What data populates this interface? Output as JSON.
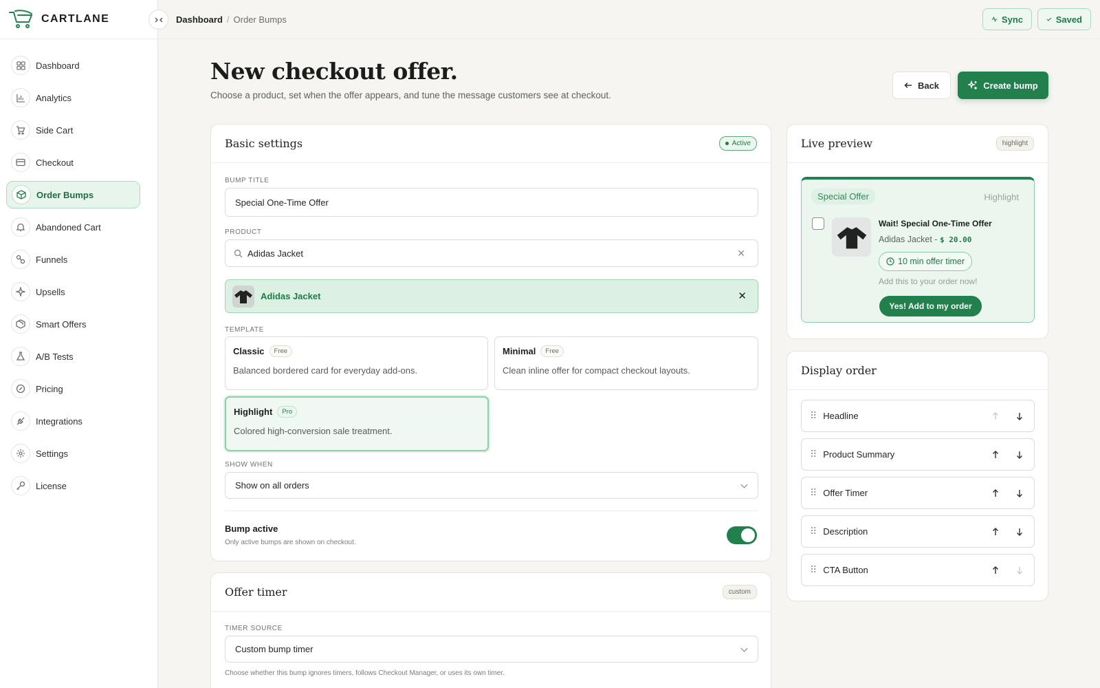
{
  "brand": {
    "name": "CARTLANE"
  },
  "sidebar": {
    "items": [
      {
        "label": "Dashboard",
        "icon": "grid-icon"
      },
      {
        "label": "Analytics",
        "icon": "bar-chart-icon"
      },
      {
        "label": "Side Cart",
        "icon": "cart-icon"
      },
      {
        "label": "Checkout",
        "icon": "card-icon"
      },
      {
        "label": "Order Bumps",
        "icon": "box-icon",
        "active": true
      },
      {
        "label": "Abandoned Cart",
        "icon": "bell-icon"
      },
      {
        "label": "Funnels",
        "icon": "funnel-icon"
      },
      {
        "label": "Upsells",
        "icon": "sparkle-icon"
      },
      {
        "label": "Smart Offers",
        "icon": "package-icon"
      },
      {
        "label": "A/B Tests",
        "icon": "flask-icon"
      },
      {
        "label": "Pricing",
        "icon": "badge-icon"
      },
      {
        "label": "Integrations",
        "icon": "plug-icon"
      },
      {
        "label": "Settings",
        "icon": "gear-icon"
      },
      {
        "label": "License",
        "icon": "key-icon"
      }
    ]
  },
  "topbar": {
    "breadcrumb": [
      "Dashboard",
      "Order Bumps"
    ],
    "sync_label": "Sync",
    "saved_label": "Saved"
  },
  "header": {
    "title": "New checkout offer.",
    "subtitle": "Choose a product, set when the offer appears, and tune the message customers see at checkout.",
    "back_label": "Back",
    "create_label": "Create bump"
  },
  "basic": {
    "title": "Basic settings",
    "status": "Active",
    "bump_title_label": "BUMP TITLE",
    "bump_title_value": "Special One-Time Offer",
    "product_label": "PRODUCT",
    "product_value": "Adidas Jacket",
    "selected_product": "Adidas Jacket",
    "template_label": "TEMPLATE",
    "templates": [
      {
        "name": "Classic",
        "tag": "Free",
        "desc": "Balanced bordered card for everyday add-ons."
      },
      {
        "name": "Minimal",
        "tag": "Free",
        "desc": "Clean inline offer for compact checkout layouts."
      },
      {
        "name": "Highlight",
        "tag": "Pro",
        "desc": "Colored high-conversion sale treatment.",
        "selected": true
      }
    ],
    "show_when_label": "SHOW WHEN",
    "show_when_value": "Show on all orders",
    "active_title": "Bump active",
    "active_help": "Only active bumps are shown on checkout.",
    "active_on": true
  },
  "timer": {
    "title": "Offer timer",
    "badge": "custom",
    "source_label": "TIMER SOURCE",
    "source_value": "Custom bump timer",
    "help": "Choose whether this bump ignores timers, follows Checkout Manager, or uses its own timer."
  },
  "preview": {
    "title": "Live preview",
    "badge": "highlight",
    "pill": "Special Offer",
    "template_name": "Highlight",
    "offer_title": "Wait! Special One-Time Offer",
    "product": "Adidas Jacket -",
    "price": "$ 20.00",
    "timer": "10 min offer timer",
    "desc": "Add this to your order now!",
    "cta": "Yes! Add to my order"
  },
  "display_order": {
    "title": "Display order",
    "items": [
      "Headline",
      "Product Summary",
      "Offer Timer",
      "Description",
      "CTA Button"
    ]
  },
  "colors": {
    "accent": "#22804c",
    "accent_soft": "#eaf6ee",
    "background": "#f6f5f1"
  }
}
